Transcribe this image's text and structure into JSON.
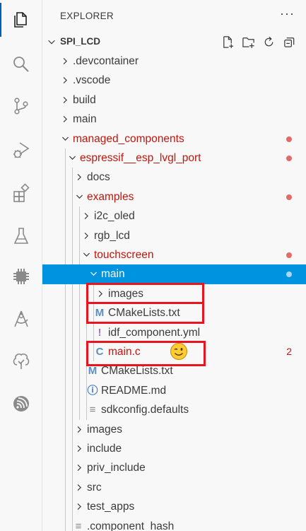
{
  "activity_bar": {
    "items": [
      {
        "icon": "files-icon",
        "active": true
      },
      {
        "icon": "search-icon"
      },
      {
        "icon": "source-control-icon"
      },
      {
        "icon": "run-debug-icon"
      },
      {
        "icon": "extensions-icon"
      },
      {
        "icon": "testing-icon"
      },
      {
        "icon": "chip-icon"
      },
      {
        "icon": "compass-icon"
      },
      {
        "icon": "tree-icon"
      },
      {
        "icon": "espressif-icon"
      }
    ]
  },
  "sidebar": {
    "title": "EXPLORER",
    "more_actions": "···"
  },
  "workspace": {
    "name": "SPI_LCD",
    "actions": [
      "new-file-icon",
      "new-folder-icon",
      "refresh-icon",
      "collapse-all-icon"
    ]
  },
  "tree": [
    {
      "label": ".devcontainer",
      "type": "folder",
      "expanded": false,
      "depth": 0
    },
    {
      "label": ".vscode",
      "type": "folder",
      "expanded": false,
      "depth": 0
    },
    {
      "label": "build",
      "type": "folder",
      "expanded": false,
      "depth": 0
    },
    {
      "label": "main",
      "type": "folder",
      "expanded": false,
      "depth": 0
    },
    {
      "label": "managed_components",
      "type": "folder",
      "expanded": true,
      "depth": 0,
      "modified": true
    },
    {
      "label": "espressif__esp_lvgl_port",
      "type": "folder",
      "expanded": true,
      "depth": 1,
      "modified": true
    },
    {
      "label": "docs",
      "type": "folder",
      "expanded": false,
      "depth": 2
    },
    {
      "label": "examples",
      "type": "folder",
      "expanded": true,
      "depth": 2,
      "modified": true
    },
    {
      "label": "i2c_oled",
      "type": "folder",
      "expanded": false,
      "depth": 3
    },
    {
      "label": "rgb_lcd",
      "type": "folder",
      "expanded": false,
      "depth": 3
    },
    {
      "label": "touchscreen",
      "type": "folder",
      "expanded": true,
      "depth": 3,
      "modified": true
    },
    {
      "label": "main",
      "type": "folder",
      "expanded": true,
      "depth": 4,
      "selected": true
    },
    {
      "label": "images",
      "type": "folder",
      "expanded": false,
      "depth": 5
    },
    {
      "label": "CMakeLists.txt",
      "type": "file",
      "icon": "M",
      "icon_name": "cmake-icon",
      "icon_color": "#5b8fc1",
      "depth": 5
    },
    {
      "label": "idf_component.yml",
      "type": "file",
      "icon": "!",
      "icon_name": "yaml-icon",
      "icon_color": "#a074c4",
      "depth": 5
    },
    {
      "label": "main.c",
      "type": "file",
      "icon": "C",
      "icon_name": "c-file-icon",
      "icon_color": "#5b8fc1",
      "depth": 5,
      "modified": true,
      "problems": "2"
    },
    {
      "label": "CMakeLists.txt",
      "type": "file",
      "icon": "M",
      "icon_name": "cmake-icon",
      "icon_color": "#5b8fc1",
      "depth": 4
    },
    {
      "label": "README.md",
      "type": "file",
      "icon": "ⓘ",
      "icon_name": "info-icon",
      "icon_color": "#3b78c3",
      "depth": 4
    },
    {
      "label": "sdkconfig.defaults",
      "type": "file",
      "icon": "≡",
      "icon_name": "settings-file-icon",
      "icon_color": "#8a8a8a",
      "depth": 4
    },
    {
      "label": "images",
      "type": "folder",
      "expanded": false,
      "depth": 2
    },
    {
      "label": "include",
      "type": "folder",
      "expanded": false,
      "depth": 2
    },
    {
      "label": "priv_include",
      "type": "folder",
      "expanded": false,
      "depth": 2
    },
    {
      "label": "src",
      "type": "folder",
      "expanded": false,
      "depth": 2
    },
    {
      "label": "test_apps",
      "type": "folder",
      "expanded": false,
      "depth": 2
    },
    {
      "label": ".component_hash",
      "type": "file",
      "icon": "≡",
      "icon_name": "settings-file-icon",
      "icon_color": "#8a8a8a",
      "depth": 2
    }
  ],
  "annotations": {
    "highlight_color": "#e8141e",
    "highlighted_rows": [
      "images",
      "CMakeLists.txt",
      "main.c"
    ],
    "emoji": "winking-face-icon"
  },
  "colors": {
    "selection": "#0093e0",
    "modified_text": "#c0160d",
    "modified_dot": "#e46a6a"
  }
}
